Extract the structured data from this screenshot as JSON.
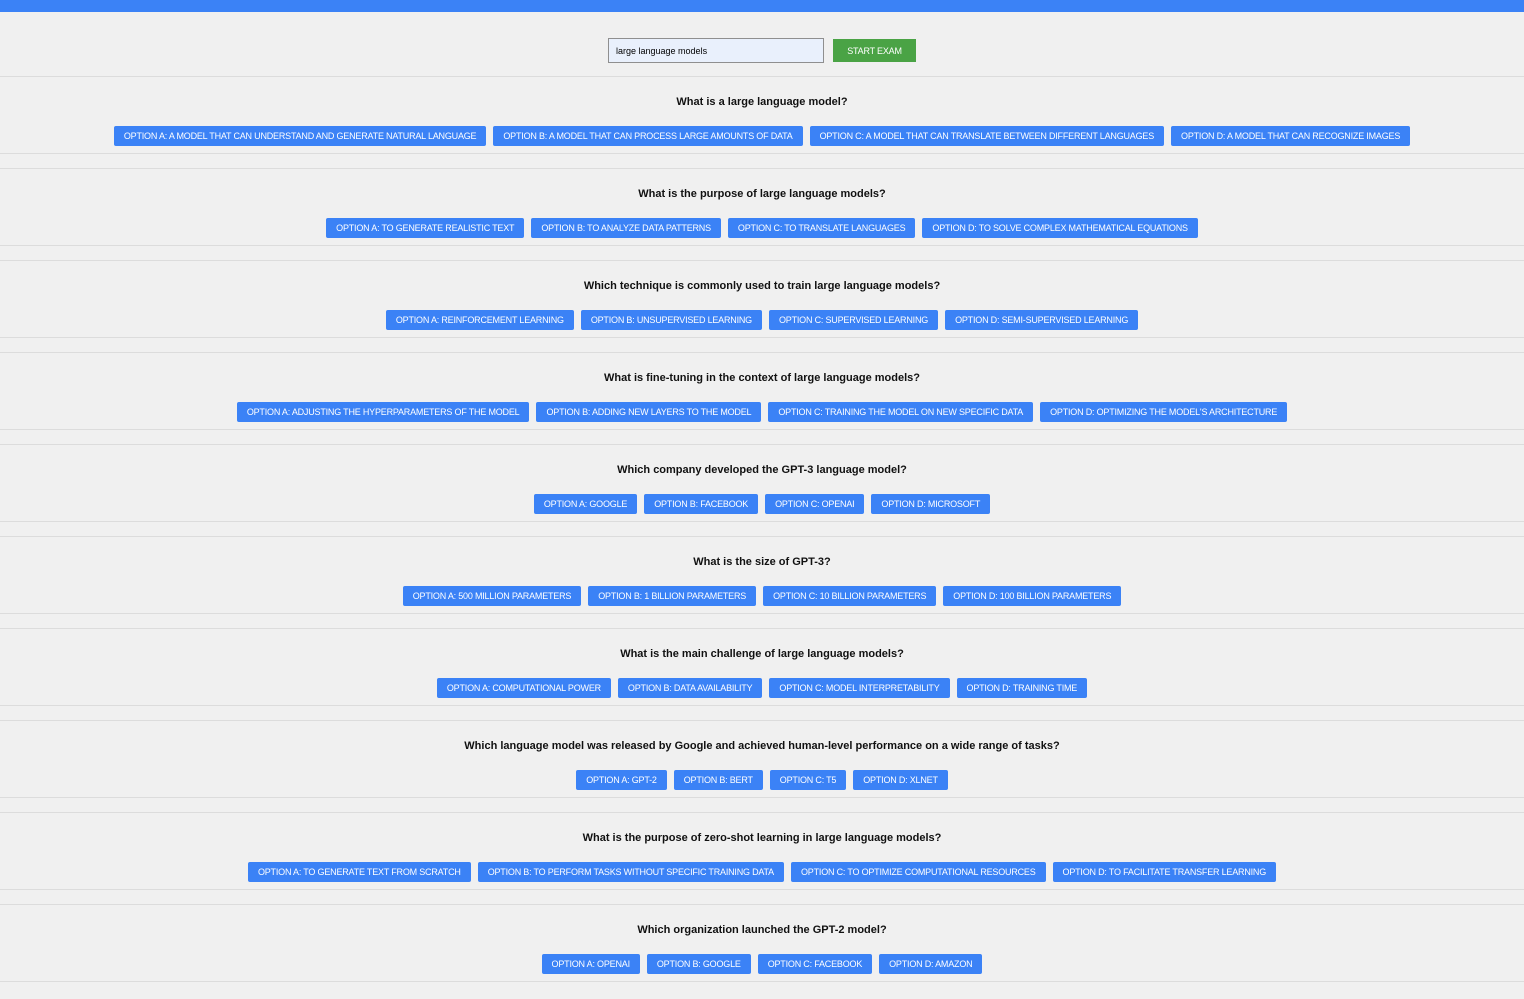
{
  "header": {
    "topic_value": "large language models",
    "start_label": "START EXAM",
    "accent_color": "#3b82f6",
    "start_color": "#4aa345"
  },
  "questions": [
    {
      "text": "What is a large language model?",
      "options": [
        "OPTION A: A MODEL THAT CAN UNDERSTAND AND GENERATE NATURAL LANGUAGE",
        "OPTION B: A MODEL THAT CAN PROCESS LARGE AMOUNTS OF DATA",
        "OPTION C: A MODEL THAT CAN TRANSLATE BETWEEN DIFFERENT LANGUAGES",
        "OPTION D: A MODEL THAT CAN RECOGNIZE IMAGES"
      ]
    },
    {
      "text": "What is the purpose of large language models?",
      "options": [
        "OPTION A: TO GENERATE REALISTIC TEXT",
        "OPTION B: TO ANALYZE DATA PATTERNS",
        "OPTION C: TO TRANSLATE LANGUAGES",
        "OPTION D: TO SOLVE COMPLEX MATHEMATICAL EQUATIONS"
      ]
    },
    {
      "text": "Which technique is commonly used to train large language models?",
      "options": [
        "OPTION A: REINFORCEMENT LEARNING",
        "OPTION B: UNSUPERVISED LEARNING",
        "OPTION C: SUPERVISED LEARNING",
        "OPTION D: SEMI-SUPERVISED LEARNING"
      ]
    },
    {
      "text": "What is fine-tuning in the context of large language models?",
      "options": [
        "OPTION A: ADJUSTING THE HYPERPARAMETERS OF THE MODEL",
        "OPTION B: ADDING NEW LAYERS TO THE MODEL",
        "OPTION C: TRAINING THE MODEL ON NEW SPECIFIC DATA",
        "OPTION D: OPTIMIZING THE MODEL'S ARCHITECTURE"
      ]
    },
    {
      "text": "Which company developed the GPT-3 language model?",
      "options": [
        "OPTION A: GOOGLE",
        "OPTION B: FACEBOOK",
        "OPTION C: OPENAI",
        "OPTION D: MICROSOFT"
      ]
    },
    {
      "text": "What is the size of GPT-3?",
      "options": [
        "OPTION A: 500 MILLION PARAMETERS",
        "OPTION B: 1 BILLION PARAMETERS",
        "OPTION C: 10 BILLION PARAMETERS",
        "OPTION D: 100 BILLION PARAMETERS"
      ]
    },
    {
      "text": "What is the main challenge of large language models?",
      "options": [
        "OPTION A: COMPUTATIONAL POWER",
        "OPTION B: DATA AVAILABILITY",
        "OPTION C: MODEL INTERPRETABILITY",
        "OPTION D: TRAINING TIME"
      ]
    },
    {
      "text": "Which language model was released by Google and achieved human-level performance on a wide range of tasks?",
      "options": [
        "OPTION A: GPT-2",
        "OPTION B: BERT",
        "OPTION C: T5",
        "OPTION D: XLNET"
      ]
    },
    {
      "text": "What is the purpose of zero-shot learning in large language models?",
      "options": [
        "OPTION A: TO GENERATE TEXT FROM SCRATCH",
        "OPTION B: TO PERFORM TASKS WITHOUT SPECIFIC TRAINING DATA",
        "OPTION C: TO OPTIMIZE COMPUTATIONAL RESOURCES",
        "OPTION D: TO FACILITATE TRANSFER LEARNING"
      ]
    },
    {
      "text": "Which organization launched the GPT-2 model?",
      "options": [
        "OPTION A: OPENAI",
        "OPTION B: GOOGLE",
        "OPTION C: FACEBOOK",
        "OPTION D: AMAZON"
      ]
    }
  ]
}
